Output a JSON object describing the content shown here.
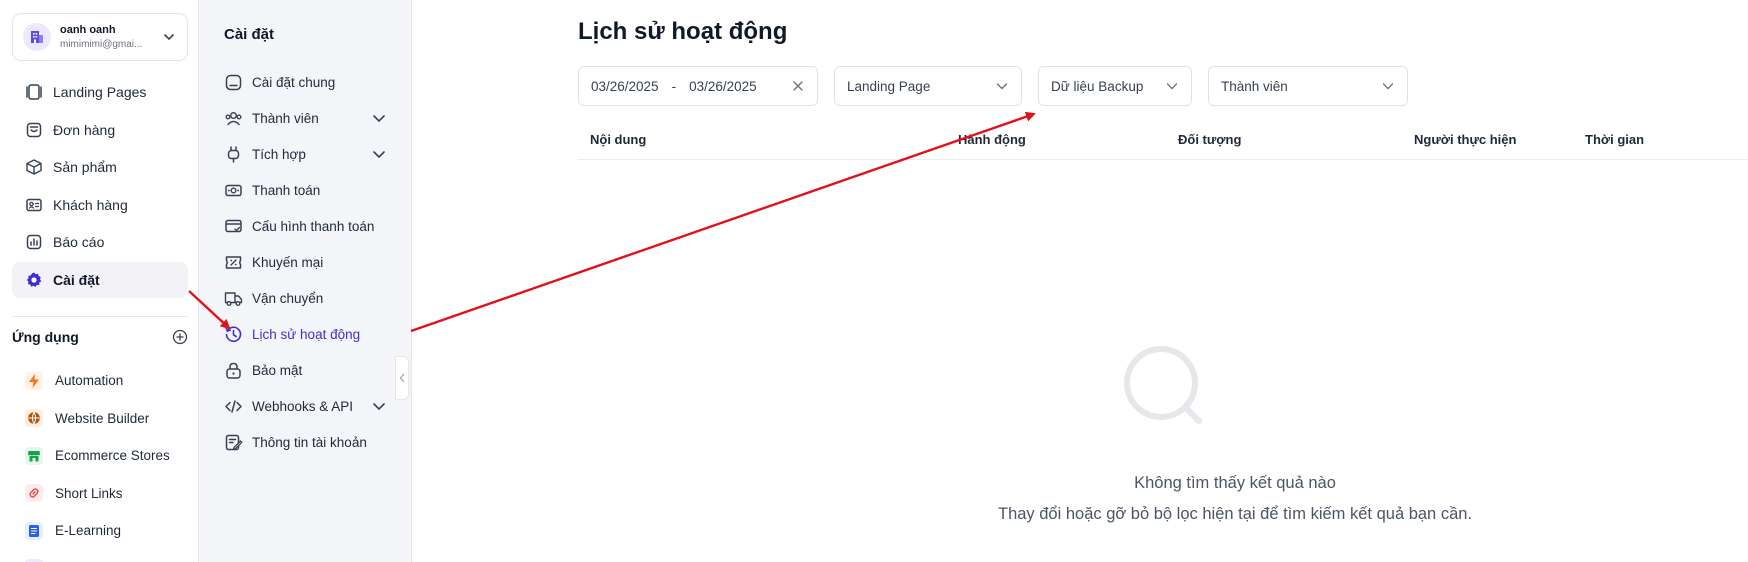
{
  "account": {
    "name": "oanh oanh",
    "email": "mimimimi@gmai..."
  },
  "nav": [
    {
      "label": "Landing Pages",
      "icon": "landing-pages-icon",
      "active": false
    },
    {
      "label": "Đơn hàng",
      "icon": "orders-icon",
      "active": false
    },
    {
      "label": "Sản phẩm",
      "icon": "box-icon",
      "active": false
    },
    {
      "label": "Khách hàng",
      "icon": "contact-card-icon",
      "active": false
    },
    {
      "label": "Báo cáo",
      "icon": "report-icon",
      "active": false
    },
    {
      "label": "Cài đặt",
      "icon": "gear-icon",
      "active": true
    }
  ],
  "apps": {
    "title": "Ứng dụng",
    "items": [
      {
        "label": "Automation",
        "icon": "lightning-icon",
        "color": "#f97316",
        "bg": "#fff1e6"
      },
      {
        "label": "Website Builder",
        "icon": "globe-icon",
        "color": "#b45309",
        "bg": "#fbeee3"
      },
      {
        "label": "Ecommerce Stores",
        "icon": "store-icon",
        "color": "#16a34a",
        "bg": "#e6f7ec"
      },
      {
        "label": "Short Links",
        "icon": "link-icon",
        "color": "#ef4444",
        "bg": "#fdecec"
      },
      {
        "label": "E-Learning",
        "icon": "book-icon",
        "color": "#2563eb",
        "bg": "#e8f0fe"
      }
    ]
  },
  "settings": {
    "title": "Cài đặt",
    "items": [
      {
        "label": "Cài đặt chung",
        "icon": "general-settings-icon",
        "chevron": false,
        "active": false
      },
      {
        "label": "Thành viên",
        "icon": "members-icon",
        "chevron": true,
        "active": false
      },
      {
        "label": "Tích hợp",
        "icon": "plug-icon",
        "chevron": true,
        "active": false
      },
      {
        "label": "Thanh toán",
        "icon": "money-icon",
        "chevron": false,
        "active": false
      },
      {
        "label": "Cấu hình thanh toán",
        "icon": "payment-config-icon",
        "chevron": false,
        "active": false
      },
      {
        "label": "Khuyến mại",
        "icon": "promo-ticket-icon",
        "chevron": false,
        "active": false
      },
      {
        "label": "Vận chuyển",
        "icon": "truck-icon",
        "chevron": false,
        "active": false
      },
      {
        "label": "Lịch sử hoạt động",
        "icon": "history-clock-icon",
        "chevron": false,
        "active": true
      },
      {
        "label": "Bảo mật",
        "icon": "lock-icon",
        "chevron": false,
        "active": false
      },
      {
        "label": "Webhooks & API",
        "icon": "code-icon",
        "chevron": true,
        "active": false
      },
      {
        "label": "Thông tin tài khoản",
        "icon": "account-info-icon",
        "chevron": false,
        "active": false
      }
    ]
  },
  "main": {
    "title": "Lịch sử hoạt động",
    "filters": {
      "date_from": "03/26/2025",
      "date_sep": "-",
      "date_to": "03/26/2025",
      "page_select": "Landing Page",
      "data_select": "Dữ liệu Backup",
      "member_select": "Thành viên"
    },
    "columns": [
      "Nội dung",
      "Hành động",
      "Đối tượng",
      "Người thực hiện",
      "Thời gian"
    ],
    "empty_title": "Không tìm thấy kết quả nào",
    "empty_subtitle": "Thay đổi hoặc gỡ bỏ bộ lọc hiện tại để tìm kiếm kết quả bạn cần."
  },
  "colors": {
    "accent": "#3f2fcf",
    "annotation_arrow": "#e3101a"
  }
}
